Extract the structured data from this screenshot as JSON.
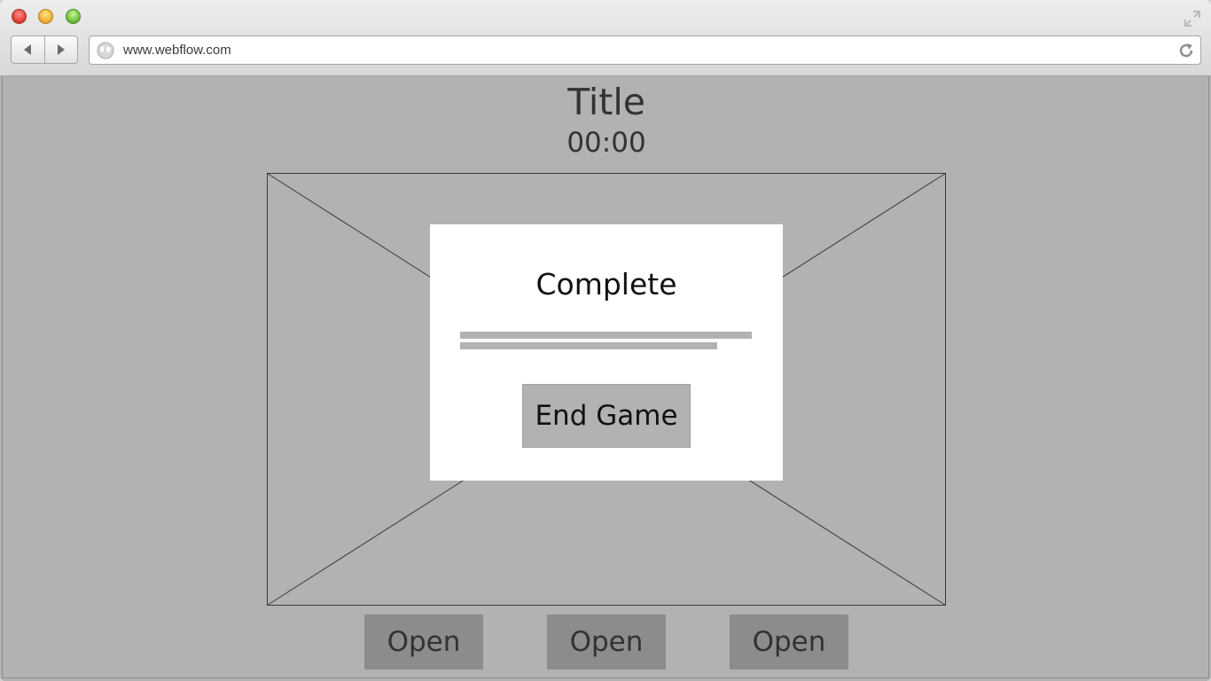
{
  "browser": {
    "url": "www.webflow.com",
    "icons": {
      "close": "close-traffic-light",
      "minimize": "minimize-traffic-light",
      "maximize": "maximize-traffic-light",
      "fullscreen": "fullscreen-icon",
      "back": "back-arrow-icon",
      "forward": "forward-arrow-icon",
      "site": "globe-icon",
      "reload": "reload-icon"
    }
  },
  "page": {
    "title": "Title",
    "timer": "00:00",
    "image_placeholder": "image-placeholder",
    "modal": {
      "title": "Complete",
      "button_label": "End Game"
    },
    "open_buttons": [
      {
        "label": "Open"
      },
      {
        "label": "Open"
      },
      {
        "label": "Open"
      }
    ]
  },
  "colors": {
    "page_background": "#b2b2b2",
    "modal_background": "#ffffff",
    "open_button": "#8c8c8c",
    "text_dark": "#333333"
  }
}
